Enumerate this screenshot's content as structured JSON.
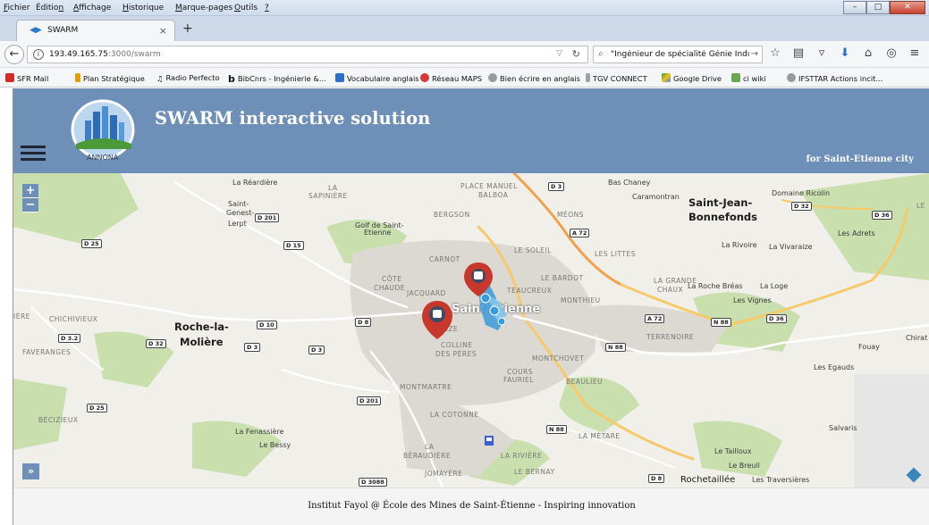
{
  "menu": {
    "items": [
      {
        "pre": "",
        "u": "F",
        "post": "ichier"
      },
      {
        "pre": "Éditio",
        "u": "n",
        "post": ""
      },
      {
        "pre": "",
        "u": "A",
        "post": "ffichage"
      },
      {
        "pre": "",
        "u": "H",
        "post": "istorique"
      },
      {
        "pre": "",
        "u": "M",
        "post": "arque-pages"
      },
      {
        "pre": "",
        "u": "O",
        "post": "utils"
      },
      {
        "pre": "",
        "u": "?",
        "post": ""
      }
    ]
  },
  "tab": {
    "favicon": "swarm-favicon",
    "title": "SWARM",
    "close": "×",
    "new": "+"
  },
  "nav": {
    "url_host": "193.49.165.75",
    "url_path": ":3000/swarm",
    "search": "\"Ingénieur de spécialité Génie Industri",
    "icons": [
      "star-icon",
      "reading-list-icon",
      "pocket-icon",
      "download-icon",
      "home-icon",
      "sync-icon",
      "menu-icon"
    ]
  },
  "bookmarks": [
    {
      "label": "SFR Mail",
      "color": "#d42a2a"
    },
    {
      "label": "Plan Stratégique",
      "color": "#e0a000"
    },
    {
      "label": "Radio Perfecto",
      "color": "#555555"
    },
    {
      "label": "BibCnrs - Ingénierie &...",
      "color": "#1a1a1a"
    },
    {
      "label": "Vocabulaire anglais",
      "color": "#2a6fc9"
    },
    {
      "label": "Réseau MAPS",
      "color": "#d23a3a"
    },
    {
      "label": "Bien écrire en anglais",
      "color": "#7a7a7a"
    },
    {
      "label": "TGV CONNECT",
      "color": "#a0a0a0"
    },
    {
      "label": "Google Drive",
      "color": "#2e9b4f"
    },
    {
      "label": "ci wiki",
      "color": "#6aa84f"
    },
    {
      "label": "IFSTTAR Actions incit...",
      "color": "#7a7a7a"
    }
  ],
  "header": {
    "logo_text": "ANNONA",
    "title": "SWARM interactive solution",
    "subtitle": "for Saint-Etienne city",
    "bg": "#6e90b8"
  },
  "map": {
    "zoom_in": "+",
    "zoom_out": "−",
    "expand": "»",
    "labels": [
      {
        "text": "La Réardière",
        "cls": ""
      },
      {
        "text": "Saint-",
        "cls": ""
      },
      {
        "text": "Genest-",
        "cls": ""
      },
      {
        "text": "Lerpt",
        "cls": ""
      },
      {
        "text": "Golf de Saint-",
        "cls": ""
      },
      {
        "text": "Etienne",
        "cls": ""
      },
      {
        "text": "LA",
        "cls": "dist"
      },
      {
        "text": "SAPINIÈRE",
        "cls": "dist"
      },
      {
        "text": "PLACE MANUEL",
        "cls": "dist"
      },
      {
        "text": "BALBOA",
        "cls": "dist"
      },
      {
        "text": "BERGSON",
        "cls": "dist"
      },
      {
        "text": "MÉONS",
        "cls": "dist"
      },
      {
        "text": "Bas Chaney",
        "cls": ""
      },
      {
        "text": "Caramontran",
        "cls": ""
      },
      {
        "text": "Saint-Jean-",
        "cls": "big"
      },
      {
        "text": "Bonnefonds",
        "cls": "big"
      },
      {
        "text": "Domaine Ricolin",
        "cls": ""
      },
      {
        "text": "Les Adrets",
        "cls": ""
      },
      {
        "text": "La Rivoire",
        "cls": ""
      },
      {
        "text": "La Vivaraize",
        "cls": ""
      },
      {
        "text": "LE SOLEIL",
        "cls": "dist"
      },
      {
        "text": "LES LITTES",
        "cls": "dist"
      },
      {
        "text": "CARNOT",
        "cls": "dist"
      },
      {
        "text": "LE BARDOT",
        "cls": "dist"
      },
      {
        "text": "CÔTE",
        "cls": "dist"
      },
      {
        "text": "CHAUDE",
        "cls": "dist"
      },
      {
        "text": "JACQUARD",
        "cls": "dist"
      },
      {
        "text": "TEAUCREUX",
        "cls": "dist"
      },
      {
        "text": "MONTHIEU",
        "cls": "dist"
      },
      {
        "text": "LA GRANDE",
        "cls": "dist"
      },
      {
        "text": "CHAUX",
        "cls": "dist"
      },
      {
        "text": "La Roche Bréas",
        "cls": ""
      },
      {
        "text": "La Loge",
        "cls": ""
      },
      {
        "text": "Les Vignes",
        "cls": ""
      },
      {
        "text": "IÈRE",
        "cls": "dist"
      },
      {
        "text": "CHICHIVIEUX",
        "cls": "dist"
      },
      {
        "text": "Roche-la-",
        "cls": "big"
      },
      {
        "text": "Molière",
        "cls": "big"
      },
      {
        "text": "FAVERANGES",
        "cls": "dist"
      },
      {
        "text": "Saint-Étienne",
        "cls": "big"
      },
      {
        "text": "AIZE",
        "cls": "dist"
      },
      {
        "text": "COLLINE",
        "cls": "dist"
      },
      {
        "text": "DES PÈRES",
        "cls": "dist"
      },
      {
        "text": "TERRENOIRE",
        "cls": "dist"
      },
      {
        "text": "Chirat",
        "cls": ""
      },
      {
        "text": "Fouay",
        "cls": ""
      },
      {
        "text": "MONTCHOVET",
        "cls": "dist"
      },
      {
        "text": "COURS",
        "cls": "dist"
      },
      {
        "text": "FAURIEL",
        "cls": "dist"
      },
      {
        "text": "BEAULIEU",
        "cls": "dist"
      },
      {
        "text": "Les Egauds",
        "cls": ""
      },
      {
        "text": "MONTMARTRE",
        "cls": "dist"
      },
      {
        "text": "LA COTONNE",
        "cls": "dist"
      },
      {
        "text": "BÉCIZIEUX",
        "cls": "dist"
      },
      {
        "text": "La Fenassière",
        "cls": ""
      },
      {
        "text": "Le Bessy",
        "cls": ""
      },
      {
        "text": "LA MÉTARE",
        "cls": "dist"
      },
      {
        "text": "Salvaris",
        "cls": ""
      },
      {
        "text": "LA",
        "cls": "dist"
      },
      {
        "text": "BÉRAUDIÈRE",
        "cls": "dist"
      },
      {
        "text": "LA RIVIÈRE",
        "cls": "dist"
      },
      {
        "text": "Le Tailloux",
        "cls": ""
      },
      {
        "text": "Le Breuil",
        "cls": ""
      },
      {
        "text": "JOMAYÈRE",
        "cls": "dist"
      },
      {
        "text": "LE BERNAY",
        "cls": "dist"
      },
      {
        "text": "Rochetaillée",
        "cls": "big"
      },
      {
        "text": "Les Traversières",
        "cls": ""
      },
      {
        "text": "LE",
        "cls": "dist"
      }
    ],
    "shields": [
      "D 3",
      "D 201",
      "D 15",
      "D 25",
      "A 72",
      "D 32",
      "D 36",
      "D 3.2",
      "D 32",
      "D 3",
      "D 10",
      "D 8",
      "D 3",
      "A 72",
      "N 88",
      "D 36",
      "N 88",
      "D 201",
      "D 25",
      "N 88",
      "D 3088",
      "D 8"
    ],
    "markers": [
      {
        "name": "bus-marker",
        "color": "#c8372b"
      },
      {
        "name": "bus-marker",
        "color": "#c8372b"
      }
    ],
    "vehicle_color": "#3a9ad9"
  },
  "footer": {
    "text": "Institut Fayol @ École des Mines de Saint-Étienne - Inspiring innovation"
  }
}
